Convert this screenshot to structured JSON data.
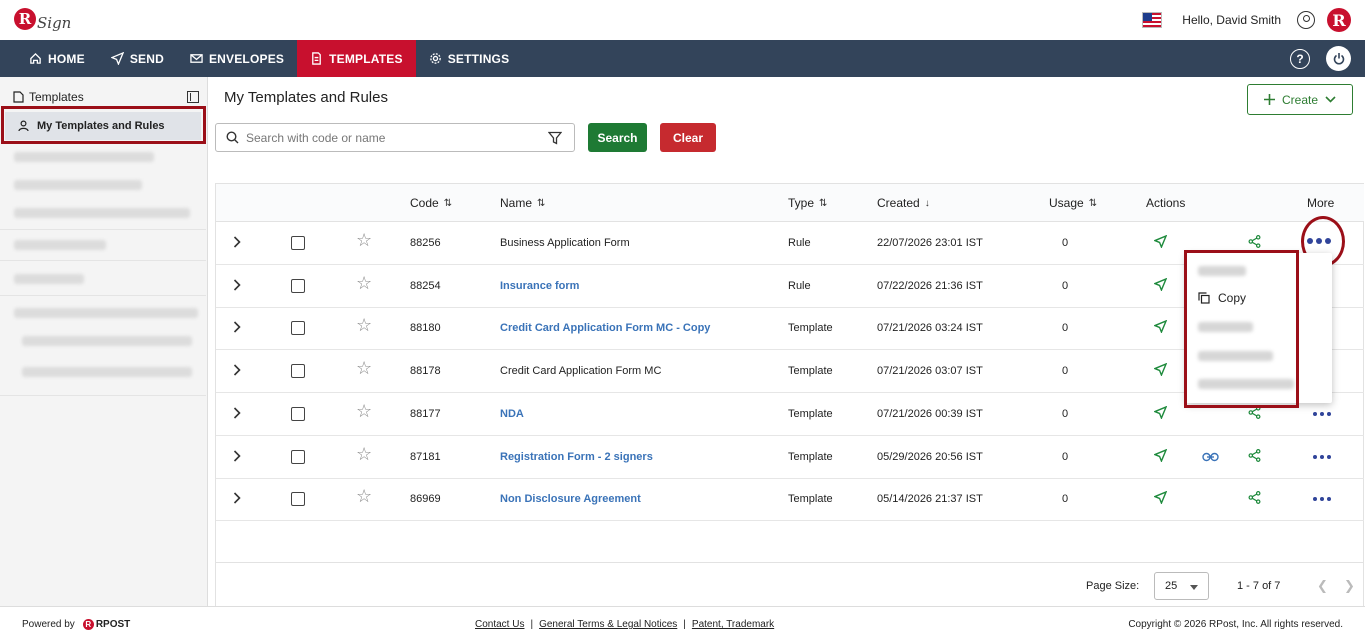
{
  "header": {
    "logo_text": "Sign",
    "logo_letter": "R",
    "greeting": "Hello, David Smith",
    "brand_letter": "R"
  },
  "nav": {
    "items": [
      {
        "label": "HOME",
        "icon": "home-icon"
      },
      {
        "label": "SEND",
        "icon": "send-icon"
      },
      {
        "label": "ENVELOPES",
        "icon": "envelope-icon"
      },
      {
        "label": "TEMPLATES",
        "icon": "template-icon",
        "active": true
      },
      {
        "label": "SETTINGS",
        "icon": "gear-icon"
      }
    ],
    "help_label": "?"
  },
  "sidebar": {
    "title": "Templates",
    "active_item": "My Templates and Rules"
  },
  "main": {
    "title": "My Templates and Rules",
    "create_label": "Create",
    "search_placeholder": "Search with code or name",
    "search_button": "Search",
    "clear_button": "Clear"
  },
  "table": {
    "columns": {
      "code": "Code",
      "name": "Name",
      "type": "Type",
      "created": "Created",
      "usage": "Usage",
      "actions": "Actions",
      "more": "More"
    },
    "rows": [
      {
        "code": "88256",
        "name": "Business Application Form",
        "type": "Rule",
        "created": "22/07/2026 23:01 IST",
        "usage": "0",
        "linked": false
      },
      {
        "code": "88254",
        "name": "Insurance form",
        "type": "Rule",
        "created": "07/22/2026 21:36 IST",
        "usage": "0",
        "linked": true
      },
      {
        "code": "88180",
        "name": "Credit Card Application Form MC - Copy",
        "type": "Template",
        "created": "07/21/2026 03:24 IST",
        "usage": "0",
        "linked": true
      },
      {
        "code": "88178",
        "name": "Credit Card Application Form MC",
        "type": "Template",
        "created": "07/21/2026 03:07 IST",
        "usage": "0",
        "linked": false
      },
      {
        "code": "88177",
        "name": "NDA",
        "type": "Template",
        "created": "07/21/2026 00:39 IST",
        "usage": "0",
        "linked": true
      },
      {
        "code": "87181",
        "name": "Registration Form - 2 signers",
        "type": "Template",
        "created": "05/29/2026 20:56 IST",
        "usage": "0",
        "linked": true
      },
      {
        "code": "86969",
        "name": "Non Disclosure Agreement",
        "type": "Template",
        "created": "05/14/2026 21:37 IST",
        "usage": "0",
        "linked": true
      }
    ]
  },
  "menu": {
    "copy_label": "Copy"
  },
  "pagination": {
    "page_size_label": "Page Size:",
    "page_size": "25",
    "range": "1 - 7 of 7"
  },
  "footer": {
    "powered_by": "Powered by",
    "rpost": "RPOST",
    "contact": "Contact Us",
    "terms": "General Terms & Legal Notices",
    "patent": "Patent, Trademark",
    "copyright": "Copyright © 2026 RPost, Inc. All rights reserved."
  },
  "colors": {
    "nav_bg": "#33445a",
    "accent_red": "#c8102e",
    "search_green": "#1e7a34",
    "link_blue": "#3a73b8",
    "highlight": "#9b0f18"
  }
}
